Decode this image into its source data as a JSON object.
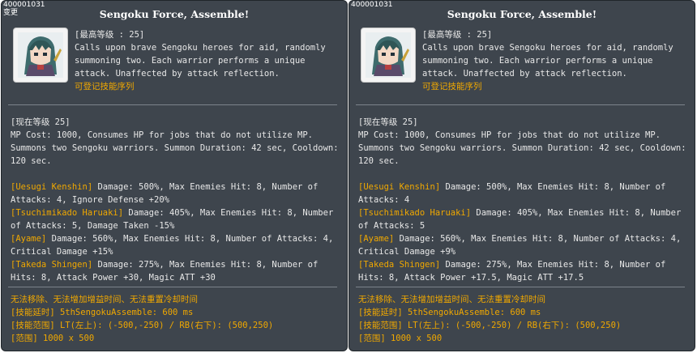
{
  "panels": [
    {
      "id_text": "400001031",
      "note_text": "变更",
      "title": "Sengoku Force, Assemble!",
      "max_level": "[最高等级 : 25]",
      "description": "Calls upon brave Sengoku heroes for aid, randomly summoning two. Each warrior performs a unique attack. Unaffected by attack reflection.",
      "registrable": "可登记技能序列",
      "current_level": "[现在等级 25]",
      "summary": "MP Cost: 1000, Consumes HP for jobs that do not utilize MP. Summons two Sengoku warriors. Summon Duration: 42 sec, Cooldown: 120 sec.",
      "warriors": [
        {
          "name": "[Uesugi Kenshin]",
          "text": " Damage: 500%, Max Enemies Hit: 8, Number of Attacks: 4, Ignore Defense +20%"
        },
        {
          "name": "[Tsuchimikado Haruaki]",
          "text": " Damage: 405%, Max Enemies Hit: 8, Number of Attacks: 5, Damage Taken -15%"
        },
        {
          "name": "[Ayame]",
          "text": " Damage: 560%, Max Enemies Hit: 8, Number of Attacks: 4, Critical Damage +15%"
        },
        {
          "name": "[Takeda Shingen]",
          "text": " Damage: 275%, Max Enemies Hit: 8, Number of Hits: 8, Attack Power +30, Magic ATT +30"
        }
      ],
      "footer": [
        "无法移除、无法增加增益时间、无法重置冷却时间",
        "[技能延时] 5thSengokuAssemble: 600 ms",
        "[技能范围] LT(左上): (-500,-250) / RB(右下): (500,250)",
        "[范围] 1000 x 500"
      ]
    },
    {
      "id_text": "400001031",
      "note_text": "",
      "title": "Sengoku Force, Assemble!",
      "max_level": "[最高等级 : 25]",
      "description": "Calls upon brave Sengoku heroes for aid, randomly summoning two. Each warrior performs a unique attack. Unaffected by attack reflection.",
      "registrable": "可登记技能序列",
      "current_level": "[现在等级 25]",
      "summary": "MP Cost: 1000, Consumes HP for jobs that do not utilize MP. Summons two Sengoku warriors. Summon Duration: 42 sec, Cooldown: 120 sec.",
      "warriors": [
        {
          "name": "[Uesugi Kenshin]",
          "text": " Damage: 500%, Max Enemies Hit: 8, Number of Attacks: 4"
        },
        {
          "name": "[Tsuchimikado Haruaki]",
          "text": " Damage: 405%, Max Enemies Hit: 8, Number of Attacks: 5"
        },
        {
          "name": "[Ayame]",
          "text": " Damage: 560%, Max Enemies Hit: 8, Number of Attacks: 4, Critical Damage +9%"
        },
        {
          "name": "[Takeda Shingen]",
          "text": " Damage: 275%, Max Enemies Hit: 8, Number of Hits: 8, Attack Power +17.5, Magic ATT +17.5"
        }
      ],
      "footer": [
        "无法移除、无法增加增益时间、无法重置冷却时间",
        "[技能延时] 5thSengokuAssemble: 600 ms",
        "[技能范围] LT(左上): (-500,-250) / RB(右下): (500,250)",
        "[范围] 1000 x 500"
      ]
    }
  ],
  "colors": {
    "panel_bg": "#3e454d",
    "text": "#e8e8e8",
    "accent": "#f0a800",
    "title": "#ffffff"
  },
  "icons": {
    "skill_icon": "sengoku-warrior-portrait-icon"
  }
}
